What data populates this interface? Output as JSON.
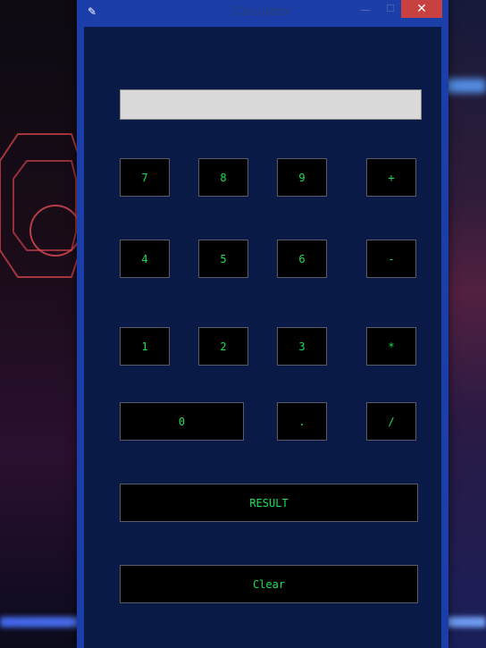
{
  "window": {
    "title": "Calculator",
    "icon": "feather-icon",
    "controls": {
      "minimize": "—",
      "maximize": "☐",
      "close": "✕"
    }
  },
  "display": {
    "value": ""
  },
  "keys": {
    "k7": "7",
    "k8": "8",
    "k9": "9",
    "plus": "+",
    "k4": "4",
    "k5": "5",
    "k6": "6",
    "minus": "-",
    "k1": "1",
    "k2": "2",
    "k3": "3",
    "multiply": "*",
    "k0": "0",
    "dot": ".",
    "divide": "/",
    "result": "RESULT",
    "clear": "Clear"
  },
  "colors": {
    "window_frame": "#1b3ea8",
    "client_background": "#0a1a47",
    "key_background": "#000000",
    "key_text": "#19e05a",
    "display_background": "#d9d9d9",
    "close_button": "#c94040"
  }
}
